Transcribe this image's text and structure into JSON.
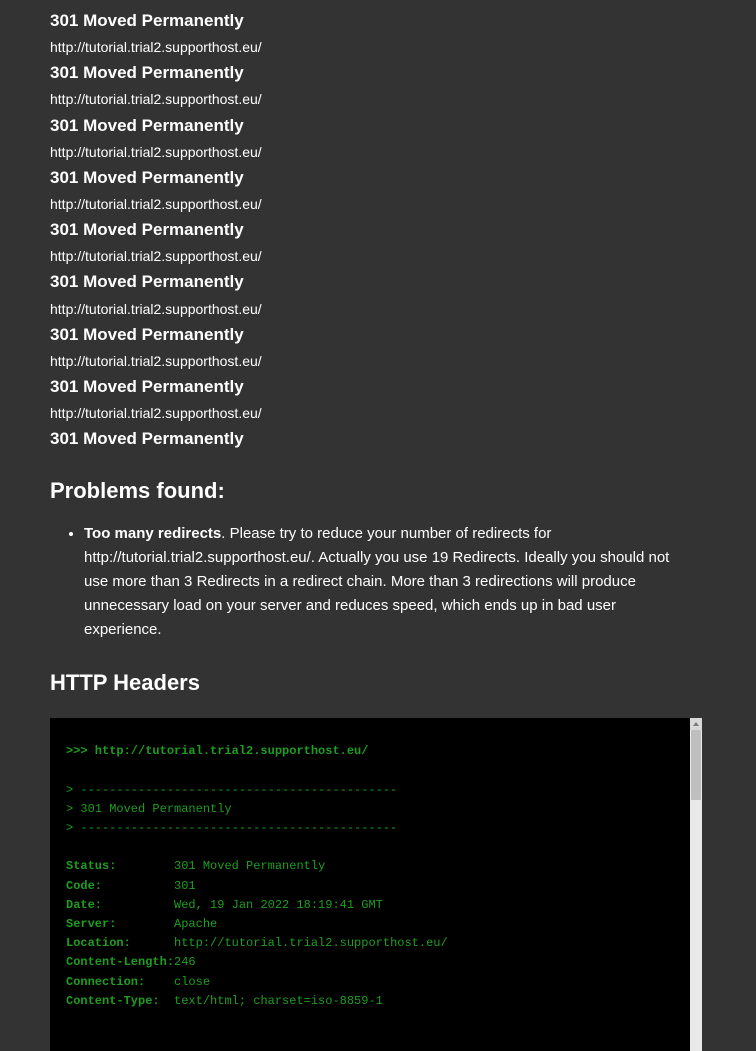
{
  "redirects": [
    {
      "status": "301 Moved Permanently",
      "url": "http://tutorial.trial2.supporthost.eu/"
    },
    {
      "status": "301 Moved Permanently",
      "url": "http://tutorial.trial2.supporthost.eu/"
    },
    {
      "status": "301 Moved Permanently",
      "url": "http://tutorial.trial2.supporthost.eu/"
    },
    {
      "status": "301 Moved Permanently",
      "url": "http://tutorial.trial2.supporthost.eu/"
    },
    {
      "status": "301 Moved Permanently",
      "url": "http://tutorial.trial2.supporthost.eu/"
    },
    {
      "status": "301 Moved Permanently",
      "url": "http://tutorial.trial2.supporthost.eu/"
    },
    {
      "status": "301 Moved Permanently",
      "url": "http://tutorial.trial2.supporthost.eu/"
    },
    {
      "status": "301 Moved Permanently",
      "url": "http://tutorial.trial2.supporthost.eu/"
    }
  ],
  "final_status": "301 Moved Permanently",
  "problems": {
    "title": "Problems found:",
    "item_bold": "Too many redirects",
    "item_rest": ". Please try to reduce your number of redirects for http://tutorial.trial2.supporthost.eu/. Actually you use 19 Redirects. Ideally you should not use more than 3 Redirects in a redirect chain. More than 3 redirections will produce unnecessary load on your server and reduces speed, which ends up in bad user experience."
  },
  "headers": {
    "title": "HTTP Headers",
    "terminal": {
      "request_line": ">>> http://tutorial.trial2.supporthost.eu/",
      "rule_prefix": "> ",
      "dashes": "--------------------------------------------",
      "status_line": "> 301 Moved Permanently",
      "fields": [
        {
          "label": "Status:",
          "value": "301 Moved Permanently"
        },
        {
          "label": "Code:",
          "value": "301"
        },
        {
          "label": "Date:",
          "value": "Wed, 19 Jan 2022 18:19:41 GMT"
        },
        {
          "label": "Server:",
          "value": "Apache"
        },
        {
          "label": "Location:",
          "value": "http://tutorial.trial2.supporthost.eu/"
        },
        {
          "label": "Content-Length:",
          "value": "246"
        },
        {
          "label": "Connection:",
          "value": "close"
        },
        {
          "label": "Content-Type:",
          "value": "text/html; charset=iso-8859-1"
        }
      ]
    }
  }
}
